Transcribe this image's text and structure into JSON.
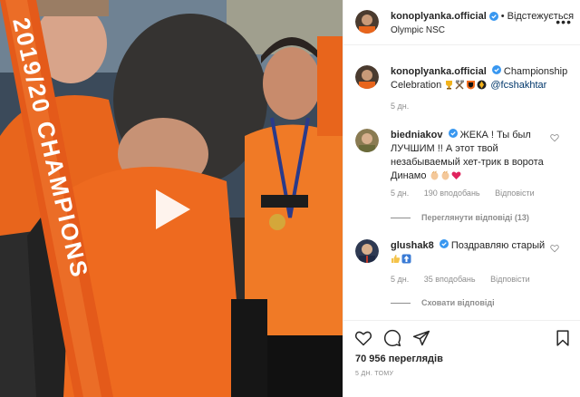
{
  "post": {
    "username": "konoplyanka.official",
    "follow_state": "Відстежується",
    "separator": "•",
    "location": "Olympic NSC"
  },
  "caption": {
    "username": "konoplyanka.official",
    "text": "Championship Celebration",
    "emojis": [
      "trophy-emoji",
      "hammer-pick-emoji",
      "shakhtar-badge-emoji",
      "ukraine-emoji"
    ],
    "mention": "@fcshakhtar",
    "time": "5 дн."
  },
  "comments": [
    {
      "username": "biedniakov",
      "text": "ЖЕКА ! Ты был ЛУЧШИМ !! А этот твой незабываемый хет-трик в ворота Динамо",
      "emojis": [
        "clap-emoji",
        "clap-emoji",
        "heart-emoji"
      ],
      "time": "5 дн.",
      "likes": "190 вподобань",
      "reply_label": "Відповісти",
      "replies_toggle": "Переглянути відповіді (13)"
    },
    {
      "username": "glushak8",
      "text": "Поздравляю старый",
      "emojis": [
        "thumbs-up-emoji",
        "up-arrow-emoji"
      ],
      "time": "5 дн.",
      "likes": "35 вподобань",
      "reply_label": "Відповісти",
      "replies_toggle": "Сховати відповіді"
    }
  ],
  "media": {
    "ribbon_text": "2019/20 CHAMPIONS"
  },
  "stats": {
    "views_number": "70 956",
    "views_label": "переглядів",
    "time_ago": "5 ДН. ТОМУ"
  },
  "colors": {
    "verified": "#3897f0",
    "orange": "#f26a1b",
    "meta_gray": "#8e8e8e",
    "mention": "#00376b"
  }
}
